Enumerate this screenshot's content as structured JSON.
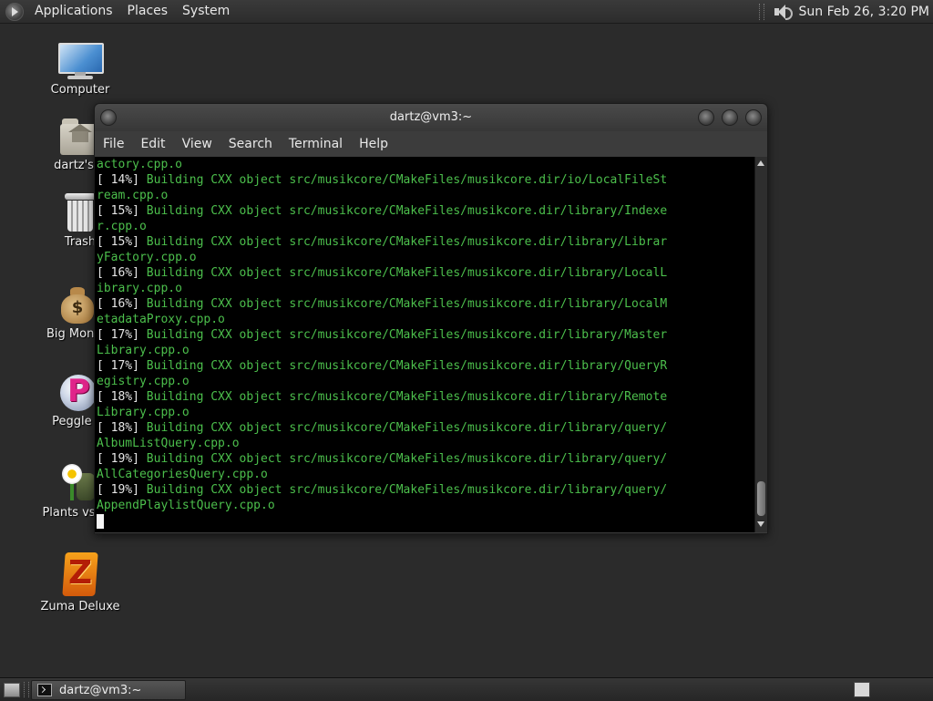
{
  "top_panel": {
    "menus": [
      "Applications",
      "Places",
      "System"
    ],
    "clock": "Sun Feb 26,  3:20 PM"
  },
  "desktop_icons": [
    {
      "label": "Computer",
      "icon": "computer-icon"
    },
    {
      "label": "dartz's H",
      "icon": "home-folder-icon"
    },
    {
      "label": "Trash",
      "icon": "trash-icon"
    },
    {
      "label": "Big Money",
      "icon": "money-bag-icon"
    },
    {
      "label": "Peggle D",
      "icon": "peggle-icon"
    },
    {
      "label": "Plants vs Zo",
      "icon": "plants-vs-zombies-icon"
    },
    {
      "label": "Zuma Deluxe",
      "icon": "zuma-icon"
    }
  ],
  "terminal": {
    "title": "dartz@vm3:~",
    "menu": [
      "File",
      "Edit",
      "View",
      "Search",
      "Terminal",
      "Help"
    ],
    "output": [
      {
        "pct": "",
        "text": "actory.cpp.o"
      },
      {
        "pct": "[ 14%]",
        "text": " Building CXX object src/musikcore/CMakeFiles/musikcore.dir/io/LocalFileSt"
      },
      {
        "pct": "",
        "text": "ream.cpp.o"
      },
      {
        "pct": "[ 15%]",
        "text": " Building CXX object src/musikcore/CMakeFiles/musikcore.dir/library/Indexe"
      },
      {
        "pct": "",
        "text": "r.cpp.o"
      },
      {
        "pct": "[ 15%]",
        "text": " Building CXX object src/musikcore/CMakeFiles/musikcore.dir/library/Librar"
      },
      {
        "pct": "",
        "text": "yFactory.cpp.o"
      },
      {
        "pct": "[ 16%]",
        "text": " Building CXX object src/musikcore/CMakeFiles/musikcore.dir/library/LocalL"
      },
      {
        "pct": "",
        "text": "ibrary.cpp.o"
      },
      {
        "pct": "[ 16%]",
        "text": " Building CXX object src/musikcore/CMakeFiles/musikcore.dir/library/LocalM"
      },
      {
        "pct": "",
        "text": "etadataProxy.cpp.o"
      },
      {
        "pct": "[ 17%]",
        "text": " Building CXX object src/musikcore/CMakeFiles/musikcore.dir/library/Master"
      },
      {
        "pct": "",
        "text": "Library.cpp.o"
      },
      {
        "pct": "[ 17%]",
        "text": " Building CXX object src/musikcore/CMakeFiles/musikcore.dir/library/QueryR"
      },
      {
        "pct": "",
        "text": "egistry.cpp.o"
      },
      {
        "pct": "[ 18%]",
        "text": " Building CXX object src/musikcore/CMakeFiles/musikcore.dir/library/Remote"
      },
      {
        "pct": "",
        "text": "Library.cpp.o"
      },
      {
        "pct": "[ 18%]",
        "text": " Building CXX object src/musikcore/CMakeFiles/musikcore.dir/library/query/"
      },
      {
        "pct": "",
        "text": "AlbumListQuery.cpp.o"
      },
      {
        "pct": "[ 19%]",
        "text": " Building CXX object src/musikcore/CMakeFiles/musikcore.dir/library/query/"
      },
      {
        "pct": "",
        "text": "AllCategoriesQuery.cpp.o"
      },
      {
        "pct": "[ 19%]",
        "text": " Building CXX object src/musikcore/CMakeFiles/musikcore.dir/library/query/"
      },
      {
        "pct": "",
        "text": "AppendPlaylistQuery.cpp.o"
      }
    ]
  },
  "taskbar": {
    "task_label": "dartz@vm3:~"
  },
  "colors": {
    "terminal_text": "#4cbf4c",
    "terminal_bg": "#000000",
    "desktop_bg": "#2b2b2b"
  }
}
